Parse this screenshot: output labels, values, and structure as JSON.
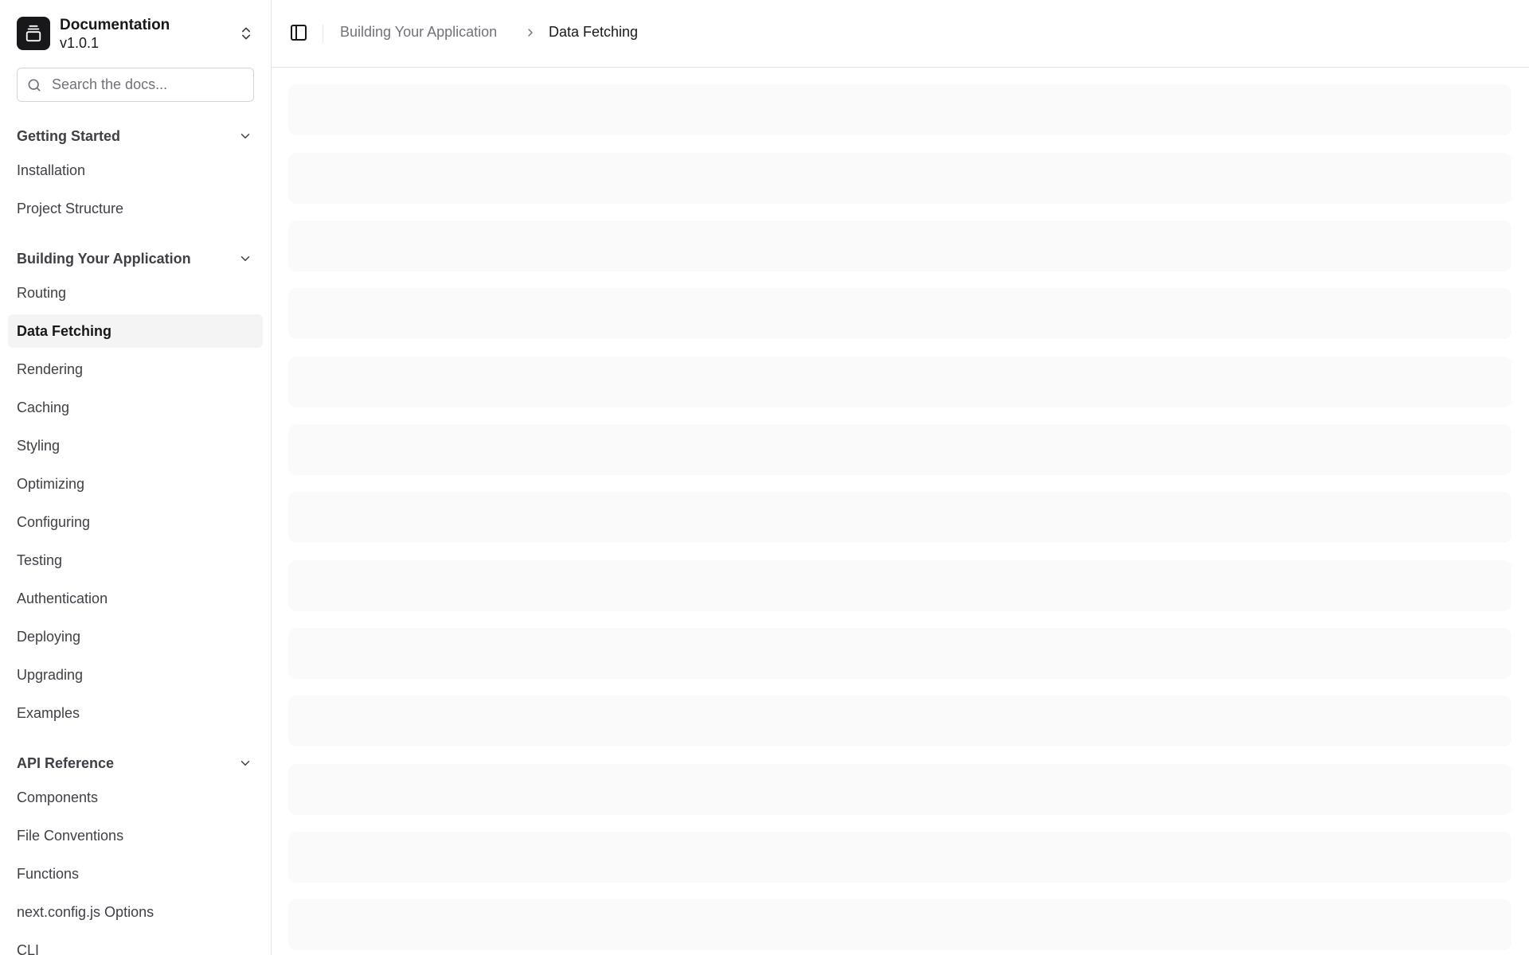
{
  "team": {
    "name": "Documentation",
    "version": "v1.0.1"
  },
  "search": {
    "placeholder": "Search the docs..."
  },
  "nav_groups": [
    {
      "label": "Getting Started",
      "items": [
        "Installation",
        "Project Structure"
      ]
    },
    {
      "label": "Building Your Application",
      "items": [
        "Routing",
        "Data Fetching",
        "Rendering",
        "Caching",
        "Styling",
        "Optimizing",
        "Configuring",
        "Testing",
        "Authentication",
        "Deploying",
        "Upgrading",
        "Examples"
      ]
    },
    {
      "label": "API Reference",
      "items": [
        "Components",
        "File Conventions",
        "Functions",
        "next.config.js Options",
        "CLI"
      ]
    }
  ],
  "active_item": "Data Fetching",
  "breadcrumb": {
    "parent": "Building Your Application",
    "current": "Data Fetching"
  },
  "skeleton_count": 13,
  "colors": {
    "skeleton": "#fafafa",
    "active_bg": "#f4f4f5",
    "border": "#e4e4e7"
  }
}
